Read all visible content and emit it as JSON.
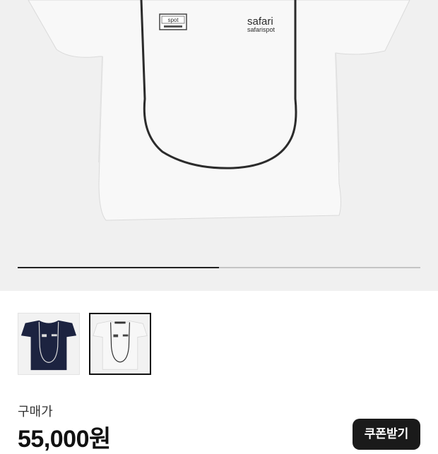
{
  "product_image": {
    "chest_logo_text": "safari",
    "chest_logo_subtext": "safarispot",
    "patch_text": "spot",
    "current_slide": 1,
    "total_slides": 2
  },
  "thumbnails": [
    {
      "color_name": "navy",
      "shirt_color": "#1c2340",
      "selected": false
    },
    {
      "color_name": "white",
      "shirt_color": "#f7f7f7",
      "selected": true
    }
  ],
  "price": {
    "label": "구매가",
    "value": "55,000원"
  },
  "coupon_button": {
    "label": "쿠폰받기"
  }
}
